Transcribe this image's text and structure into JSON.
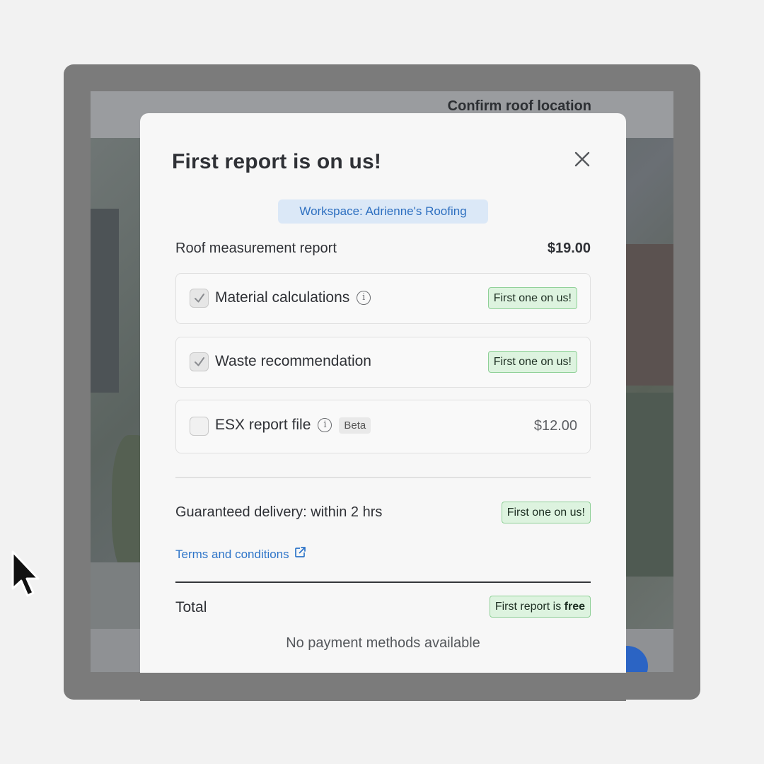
{
  "background_app": {
    "header_title": "Confirm roof location"
  },
  "modal": {
    "title": "First report is on us!",
    "close_icon": "close-icon",
    "workspace_label": "Workspace: Adrienne's Roofing",
    "report": {
      "label": "Roof measurement report",
      "price": "$19.00"
    },
    "options": [
      {
        "label": "Material calculations",
        "checked": true,
        "info": true,
        "badge": "First one on us!"
      },
      {
        "label": "Waste recommendation",
        "checked": true,
        "info": false,
        "badge": "First one on us!"
      },
      {
        "label": "ESX report file",
        "checked": false,
        "info": true,
        "tag": "Beta",
        "price": "$12.00"
      }
    ],
    "delivery": {
      "label": "Guaranteed delivery: within 2 hrs",
      "badge": "First one on us!"
    },
    "terms_link": "Terms and conditions",
    "total": {
      "label": "Total",
      "badge_prefix": "First report is ",
      "badge_bold": "free"
    },
    "payment_status": "No payment methods available"
  },
  "colors": {
    "accent_blue": "#2d74c8",
    "badge_green_bg": "#ddf3df",
    "badge_green_border": "#8fd097",
    "workspace_bg": "#dbe8f7"
  }
}
